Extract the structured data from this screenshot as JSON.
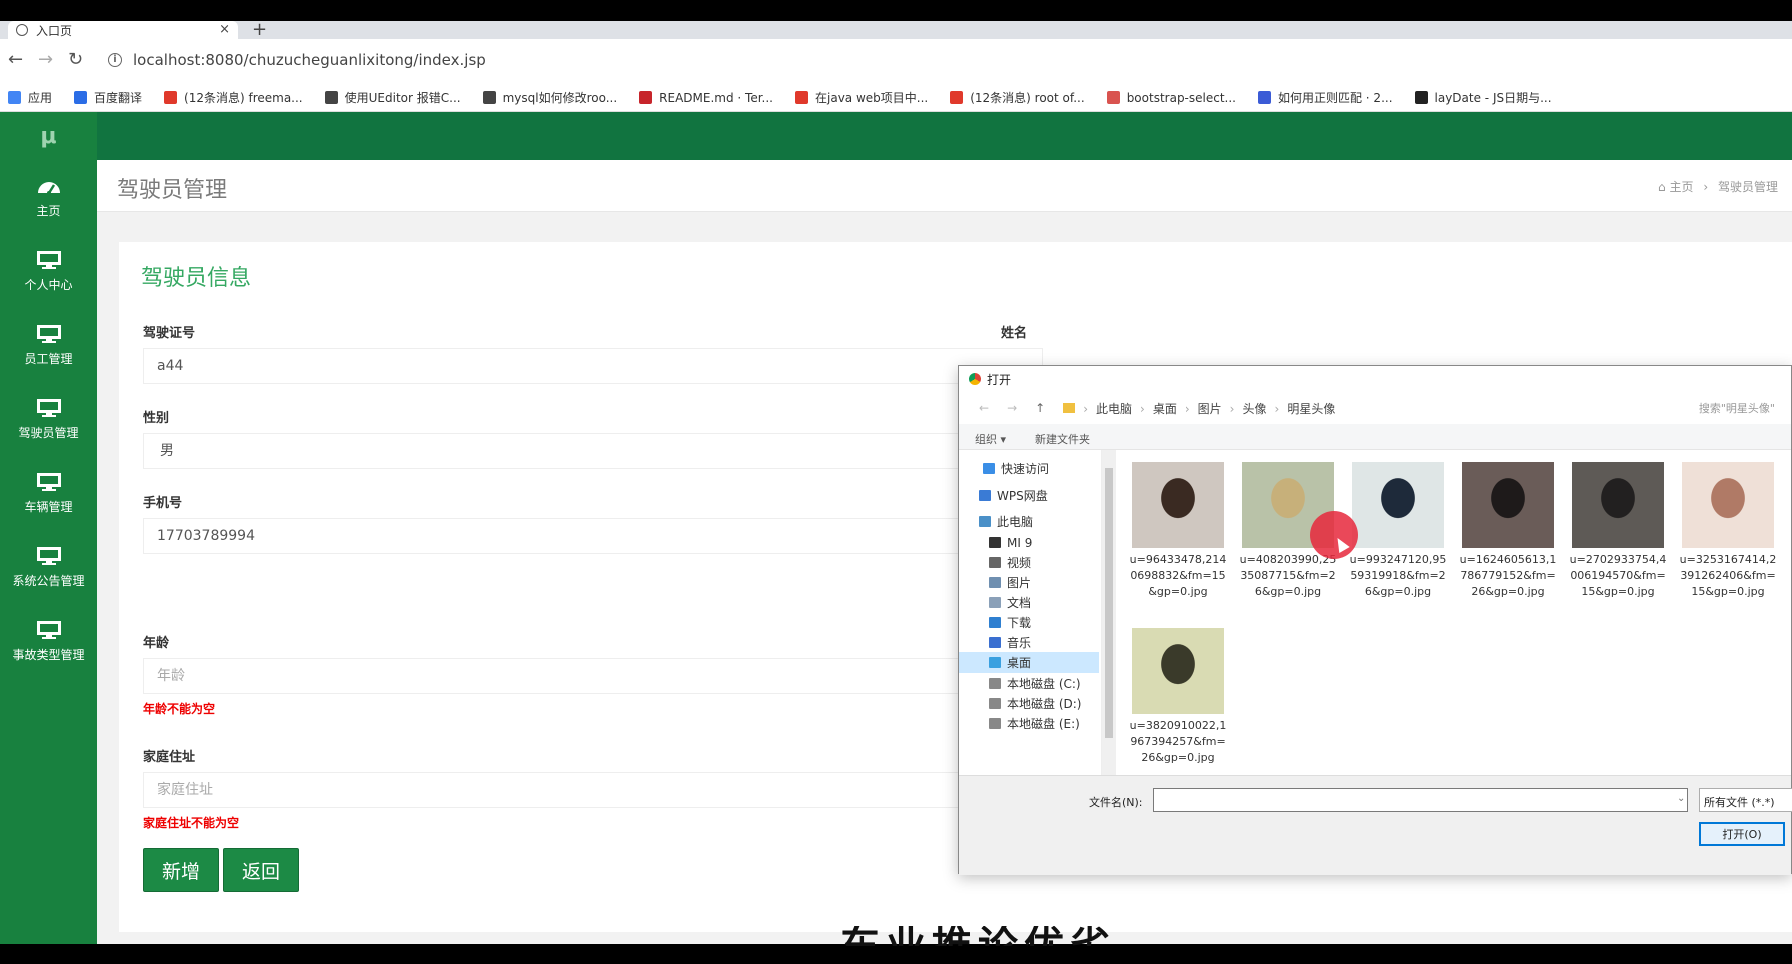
{
  "browser": {
    "tab_title": "入口页",
    "tab_close": "×",
    "new_tab": "+",
    "url": "localhost:8080/chuzucheguanlixitong/index.jsp",
    "bookmarks": [
      {
        "label": "应用",
        "color": "#4285f4"
      },
      {
        "label": "百度翻译",
        "color": "#2b6de6"
      },
      {
        "label": "(12条消息) freema...",
        "color": "#e0392b"
      },
      {
        "label": "使用UEditor 报错C...",
        "color": "#444444"
      },
      {
        "label": "mysql如何修改roo...",
        "color": "#444444"
      },
      {
        "label": "README.md · Ter...",
        "color": "#c7252b"
      },
      {
        "label": "在java web项目中...",
        "color": "#e0392b"
      },
      {
        "label": "(12条消息) root of...",
        "color": "#e0392b"
      },
      {
        "label": "bootstrap-select...",
        "color": "#d9534f"
      },
      {
        "label": "如何用正则匹配 · 2...",
        "color": "#3b5bd6"
      },
      {
        "label": "layDate - JS日期与...",
        "color": "#222222"
      }
    ]
  },
  "sidebar": {
    "logo": "μ",
    "items": [
      {
        "label": "主页",
        "icon": "dashboard-icon"
      },
      {
        "label": "个人中心",
        "icon": "monitor-icon"
      },
      {
        "label": "员工管理",
        "icon": "monitor-icon"
      },
      {
        "label": "驾驶员管理",
        "icon": "monitor-icon"
      },
      {
        "label": "车辆管理",
        "icon": "monitor-icon"
      },
      {
        "label": "系统公告管理",
        "icon": "monitor-icon"
      },
      {
        "label": "事故类型管理",
        "icon": "monitor-icon"
      }
    ]
  },
  "header": {
    "page_title": "驾驶员管理",
    "crumb_home": "主页",
    "crumb_sep": "›",
    "crumb_current": "驾驶员管理"
  },
  "form": {
    "panel_title": "驾驶员信息",
    "license_label": "驾驶证号",
    "license_value": "a44",
    "name_label": "姓名",
    "gender_label": "性别",
    "gender_value": "男",
    "phone_label": "手机号",
    "phone_value": "17703789994",
    "age_label": "年龄",
    "age_placeholder": "年龄",
    "age_error": "年龄不能为空",
    "address_label": "家庭住址",
    "address_placeholder": "家庭住址",
    "address_error": "家庭住址不能为空",
    "add_button": "新增",
    "back_button": "返回"
  },
  "subtitle_overlay": "车业推论优劣",
  "dialog": {
    "title": "打开",
    "path": [
      "此电脑",
      "桌面",
      "图片",
      "头像",
      "明星头像"
    ],
    "search_placeholder": "搜索\"明星头像\"",
    "organize": "组织 ▾",
    "new_folder": "新建文件夹",
    "nav": [
      {
        "label": "快速访问",
        "color": "#3a8ee6"
      },
      {
        "label": "WPS网盘",
        "color": "#3a7bd5"
      },
      {
        "label": "此电脑",
        "color": "#4a90c8"
      },
      {
        "label": "MI 9",
        "color": "#333333"
      },
      {
        "label": "视频",
        "color": "#666666"
      },
      {
        "label": "图片",
        "color": "#6f8fb0"
      },
      {
        "label": "文档",
        "color": "#8aa0b8"
      },
      {
        "label": "下载",
        "color": "#2f7fd0"
      },
      {
        "label": "音乐",
        "color": "#3a6fd0"
      },
      {
        "label": "桌面",
        "color": "#3aa0e0"
      },
      {
        "label": "本地磁盘 (C:)",
        "color": "#888888"
      },
      {
        "label": "本地磁盘 (D:)",
        "color": "#888888"
      },
      {
        "label": "本地磁盘 (E:)",
        "color": "#888888"
      }
    ],
    "selected_nav": "桌面",
    "files": [
      {
        "name": "u=96433478,2140698832&fm=15&gp=0.jpg",
        "bg": "#cfc7c0",
        "fg": "#3a2a22"
      },
      {
        "name": "u=408203990,2535087715&fm=26&gp=0.jpg",
        "bg": "#b9c2a8",
        "fg": "#c7b07a"
      },
      {
        "name": "u=993247120,9559319918&fm=26&gp=0.jpg",
        "bg": "#dfe6e6",
        "fg": "#1e2a3a"
      },
      {
        "name": "u=1624605613,1786779152&fm=26&gp=0.jpg",
        "bg": "#6a5c58",
        "fg": "#1e1a1a"
      },
      {
        "name": "u=2702933754,4006194570&fm=15&gp=0.jpg",
        "bg": "#5e5a56",
        "fg": "#222020"
      },
      {
        "name": "u=3253167414,2391262406&fm=15&gp=0.jpg",
        "bg": "#efe0d7",
        "fg": "#b07a66"
      },
      {
        "name": "u=3820910022,1967394257&fm=26&gp=0.jpg",
        "bg": "#d9dbb3",
        "fg": "#3a3a2a"
      }
    ],
    "filename_label": "文件名(N):",
    "filename_value": "",
    "filetype": "所有文件 (*.*)",
    "open_button": "打开(O)"
  }
}
